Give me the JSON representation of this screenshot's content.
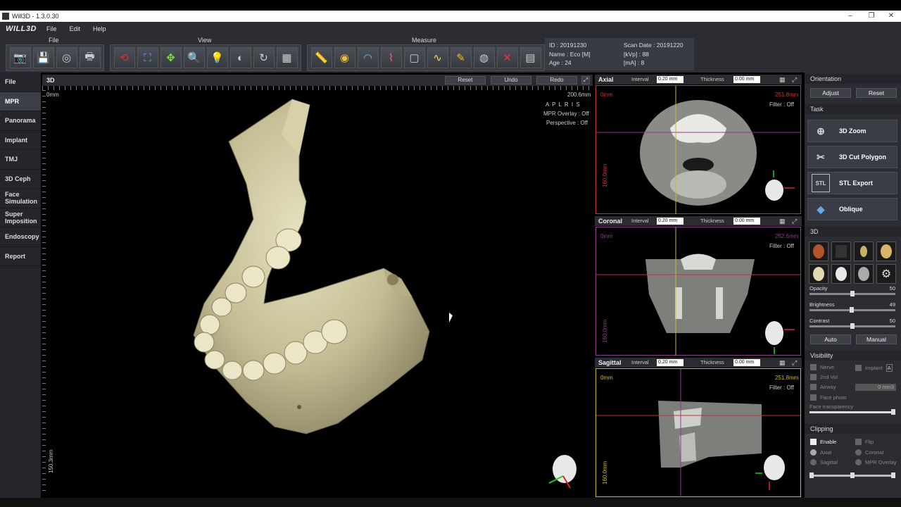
{
  "app": {
    "title": "Will3D - 1.3.0.30",
    "logo": "WILL3D"
  },
  "menu": [
    "File",
    "Edit",
    "Help"
  ],
  "toolbar": {
    "groups": [
      {
        "label": "File"
      },
      {
        "label": "View"
      },
      {
        "label": "Measure"
      }
    ]
  },
  "patient": {
    "id": "ID : 20191230",
    "name": "Name : Eco [M]",
    "age": "Age : 24",
    "scan_date": "Scan Date : 20191220",
    "kvp": "[kVp] : 88",
    "ma": "[mA] : 8"
  },
  "left_tabs": [
    "File",
    "MPR",
    "Panorama",
    "Implant",
    "TMJ",
    "3D Ceph",
    "Face Simulation",
    "Super Imposition",
    "Endoscopy",
    "Report"
  ],
  "view3d": {
    "title": "3D",
    "reset": "Reset",
    "undo": "Undo",
    "redo": "Redo",
    "origin": "0mm",
    "size": "200.6mm",
    "orient": "A P L R I S",
    "mpr_overlay": "MPR Overlay : Off",
    "perspective": "Perspective : Off",
    "bottom_scale": "150.3mm"
  },
  "axial": {
    "title": "Axial",
    "interval_label": "Interval",
    "interval": "0.20 mm",
    "thickness_label": "Thickness",
    "thickness": "0.00 mm",
    "origin": "0mm",
    "size": "251.8mm",
    "filter": "Filter : Off",
    "side": "160.0mm"
  },
  "coronal": {
    "title": "Coronal",
    "interval_label": "Interval",
    "interval": "0.20 mm",
    "thickness_label": "Thickness",
    "thickness": "0.00 mm",
    "origin": "0mm",
    "size": "252.6mm",
    "filter": "Filter : Off",
    "side": "160.0mm"
  },
  "sagittal": {
    "title": "Sagittal",
    "interval_label": "Interval",
    "interval": "0.20 mm",
    "thickness_label": "Thickness",
    "thickness": "0.00 mm",
    "origin": "0mm",
    "size": "251.8mm",
    "filter": "Filter : Off",
    "side": "160.0mm"
  },
  "right": {
    "orientation": "Orientation",
    "adjust": "Adjust",
    "reset": "Reset",
    "task": "Task",
    "tasks": [
      "3D Zoom",
      "3D Cut Polygon",
      "STL Export",
      "Oblique"
    ],
    "section3d": "3D",
    "opacity": {
      "label": "Opacity",
      "value": "50"
    },
    "brightness": {
      "label": "Brightness",
      "value": "49"
    },
    "contrast": {
      "label": "Contrast",
      "value": "50"
    },
    "auto": "Auto",
    "manual": "Manual",
    "visibility": "Visibility",
    "nerve": "Nerve",
    "implant": "Implant",
    "implant_badge": "A",
    "second_vol": "2nd Vol",
    "airway": "Airway",
    "airway_value": "0 mm3",
    "face_photo": "Face photo",
    "face_transparency": "Face transparency",
    "clipping": "Clipping",
    "enable": "Enable",
    "flip": "Flip",
    "axial": "Axial",
    "coronal": "Coronal",
    "sagittal": "Sagittal",
    "mpr_overlay": "MPR Overlay"
  },
  "colors": {
    "axial": "#c0333d",
    "coronal": "#8c3d88",
    "sagittal": "#c8b838",
    "accent": "#3c3f47"
  }
}
